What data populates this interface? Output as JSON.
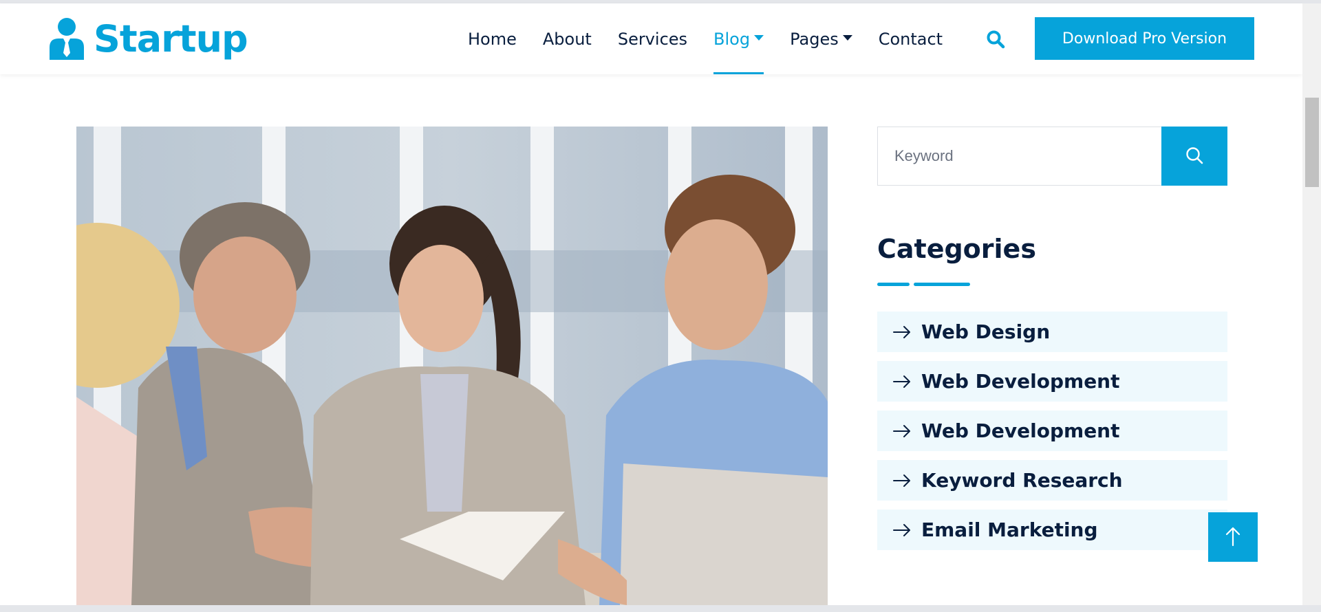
{
  "brand": {
    "name": "Startup",
    "icon": "user-tie-icon"
  },
  "nav": {
    "items": [
      {
        "label": "Home",
        "active": false,
        "dropdown": false
      },
      {
        "label": "About",
        "active": false,
        "dropdown": false
      },
      {
        "label": "Services",
        "active": false,
        "dropdown": false
      },
      {
        "label": "Blog",
        "active": true,
        "dropdown": true
      },
      {
        "label": "Pages",
        "active": false,
        "dropdown": true
      },
      {
        "label": "Contact",
        "active": false,
        "dropdown": false
      }
    ],
    "search_icon": "search-icon",
    "cta_label": "Download Pro Version"
  },
  "sidebar": {
    "search": {
      "placeholder": "Keyword",
      "value": ""
    },
    "categories_title": "Categories",
    "categories": [
      {
        "label": "Web Design"
      },
      {
        "label": "Web Development"
      },
      {
        "label": "Web Development"
      },
      {
        "label": "Keyword Research"
      },
      {
        "label": "Email Marketing"
      }
    ]
  },
  "colors": {
    "primary": "#06a3da",
    "dark": "#091e3e",
    "light_bg": "#eef9fd"
  }
}
